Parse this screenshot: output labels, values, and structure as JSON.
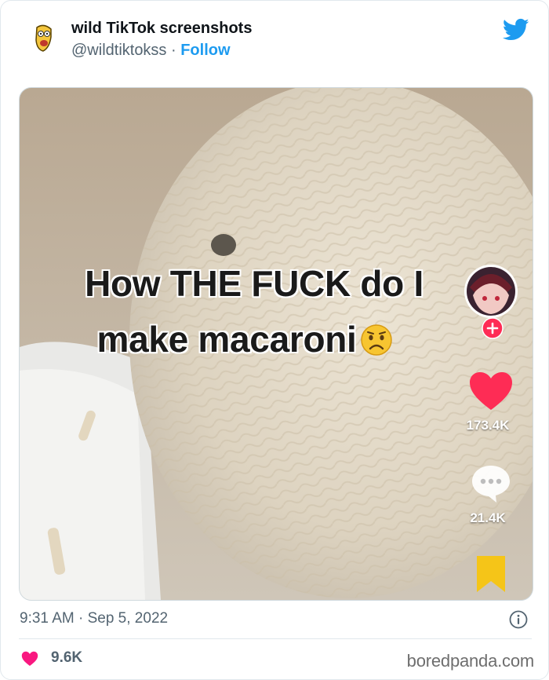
{
  "tweet": {
    "author_name": "wild TikTok screenshots",
    "handle": "@wildtiktokss",
    "separator": " · ",
    "follow_label": "Follow",
    "timestamp": "9:31 AM · Sep 5, 2022",
    "like_count": "9.6K"
  },
  "media": {
    "overlay_line1": "How THE FUCK do I",
    "overlay_line2": "make macaroni",
    "emoji": "worried-face-icon",
    "tiktok_likes": "173.4K",
    "tiktok_comments": "21.4K"
  },
  "colors": {
    "twitter_blue": "#1d9bf0",
    "like_red": "#f91880",
    "tiktok_red": "#fe2c55",
    "bookmark_yellow": "#f5c518"
  },
  "watermark": "boredpanda.com"
}
